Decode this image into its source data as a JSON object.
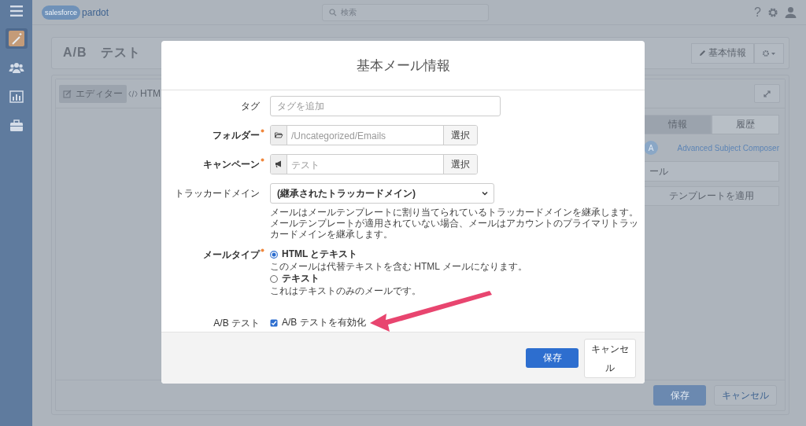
{
  "app": {
    "logo": {
      "brand": "salesforce",
      "product": "pardot"
    },
    "search": {
      "placeholder": "検索"
    },
    "help_icon": "?",
    "sidebar": {
      "items": [
        {
          "kind": "wand",
          "selected": true
        },
        {
          "kind": "people",
          "selected": false
        },
        {
          "kind": "chart",
          "selected": false
        },
        {
          "kind": "briefcase",
          "selected": false
        }
      ]
    },
    "page_title": "A/B　テスト",
    "header_button": "基本情報",
    "editor_tabs": [
      {
        "kind": "edit",
        "label": "エディター",
        "selected": true
      },
      {
        "kind": "code",
        "label": "HTM",
        "selected": false
      }
    ],
    "side_tabs": [
      {
        "label": "情報",
        "selected": true
      },
      {
        "label": "履歴",
        "selected": false
      }
    ],
    "avatar_letter": "A",
    "composer_link": "Advanced Subject Composer",
    "subject_field_value": "ール",
    "apply_template_button": "テンプレートを適用",
    "footer_buttons": {
      "save": "保存",
      "cancel": "キャンセル"
    }
  },
  "dialog": {
    "title": "基本メール情報",
    "fields": [
      {
        "kind": "text",
        "label": "タグ",
        "required": false,
        "placeholder": "タグを追加"
      },
      {
        "kind": "folder_picker",
        "label": "フォルダー",
        "required": true,
        "placeholder": "/Uncategorized/Emails",
        "button": "選択"
      },
      {
        "kind": "campaign_picker",
        "label": "キャンペーン",
        "required": true,
        "placeholder": "テスト",
        "button": "選択"
      },
      {
        "kind": "select",
        "label": "トラッカードメイン",
        "required": false,
        "value": "(継承されたトラッカードメイン)",
        "help": [
          "メールはメールテンプレートに割り当てられているトラッカードメインを継承します。",
          "メールテンプレートが適用されていない場合、メールはアカウントのプライマリトラッカードメインを継承します。"
        ]
      },
      {
        "kind": "radio",
        "label": "メールタイプ",
        "required": true,
        "options": [
          {
            "label": "HTML とテキスト",
            "selected": true,
            "help": "このメールは代替テキストを含む HTML メールになります。"
          },
          {
            "label": "テキスト",
            "selected": false,
            "help": "これはテキストのみのメールです。"
          }
        ]
      },
      {
        "kind": "checkbox",
        "label": "A/B テスト",
        "required": false,
        "option": "A/B テストを有効化",
        "checked": true
      }
    ],
    "buttons": {
      "save": "保存",
      "cancel": "キャンセル"
    }
  }
}
